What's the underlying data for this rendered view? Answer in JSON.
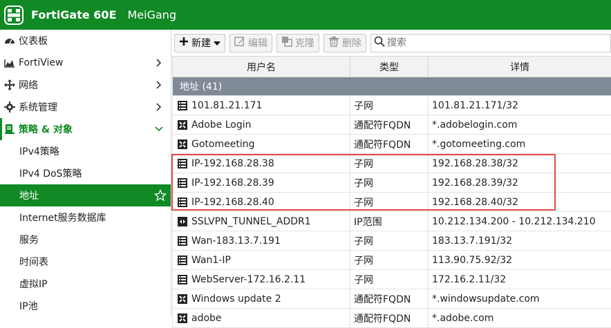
{
  "app": {
    "product": "FortiGate 60E",
    "hostname": "MeiGang"
  },
  "sidebar": {
    "items": [
      {
        "label": "仪表板",
        "icon": "dashboard-icon",
        "chevron": ""
      },
      {
        "label": "FortiView",
        "icon": "chart-icon",
        "chevron": "right"
      },
      {
        "label": "网络",
        "icon": "network-icon",
        "chevron": "right"
      },
      {
        "label": "系统管理",
        "icon": "gear-icon",
        "chevron": "right"
      },
      {
        "label": "策略 & 对象",
        "icon": "policy-icon",
        "chevron": "down"
      }
    ],
    "subitems": [
      {
        "label": "IPv4策略"
      },
      {
        "label": "IPv4 DoS策略"
      },
      {
        "label": "地址",
        "selected": true
      },
      {
        "label": "Internet服务数据库"
      },
      {
        "label": "服务"
      },
      {
        "label": "时间表"
      },
      {
        "label": "虚拟IP"
      },
      {
        "label": "IP池"
      }
    ]
  },
  "toolbar": {
    "new_label": "新建",
    "edit_label": "编辑",
    "clone_label": "克隆",
    "delete_label": "删除",
    "search_placeholder": "搜索"
  },
  "table": {
    "headers": [
      "用户名",
      "类型",
      "详情"
    ],
    "group_label": "地址 (41)",
    "rows": [
      {
        "name": "101.81.21.171",
        "type": "子网",
        "detail": "101.81.21.171/32",
        "icon": "subnet-icon"
      },
      {
        "name": "Adobe Login",
        "type": "通配符FQDN",
        "detail": "*.adobelogin.com",
        "icon": "fqdn-icon"
      },
      {
        "name": "Gotomeeting",
        "type": "通配符FQDN",
        "detail": "*.gotomeeting.com",
        "icon": "fqdn-icon"
      },
      {
        "name": "IP-192.168.28.38",
        "type": "子网",
        "detail": "192.168.28.38/32",
        "icon": "subnet-icon"
      },
      {
        "name": "IP-192.168.28.39",
        "type": "子网",
        "detail": "192.168.28.39/32",
        "icon": "subnet-icon"
      },
      {
        "name": "IP-192.168.28.40",
        "type": "子网",
        "detail": "192.168.28.40/32",
        "icon": "subnet-icon"
      },
      {
        "name": "SSLVPN_TUNNEL_ADDR1",
        "type": "IP范围",
        "detail": "10.212.134.200 - 10.212.134.210",
        "icon": "range-icon"
      },
      {
        "name": "Wan-183.13.7.191",
        "type": "子网",
        "detail": "183.13.7.191/32",
        "icon": "subnet-icon"
      },
      {
        "name": "Wan1-IP",
        "type": "子网",
        "detail": "113.90.75.92/32",
        "icon": "subnet-icon"
      },
      {
        "name": "WebServer-172.16.2.11",
        "type": "子网",
        "detail": "172.16.2.11/32",
        "icon": "subnet-icon"
      },
      {
        "name": "Windows update 2",
        "type": "通配符FQDN",
        "detail": "*.windowsupdate.com",
        "icon": "fqdn-icon"
      },
      {
        "name": "adobe",
        "type": "通配符FQDN",
        "detail": "*.adobe.com",
        "icon": "fqdn-icon"
      }
    ]
  },
  "colors": {
    "brand": "#118a25",
    "group_bar": "#7f8a96",
    "highlight": "#e04a4a"
  }
}
